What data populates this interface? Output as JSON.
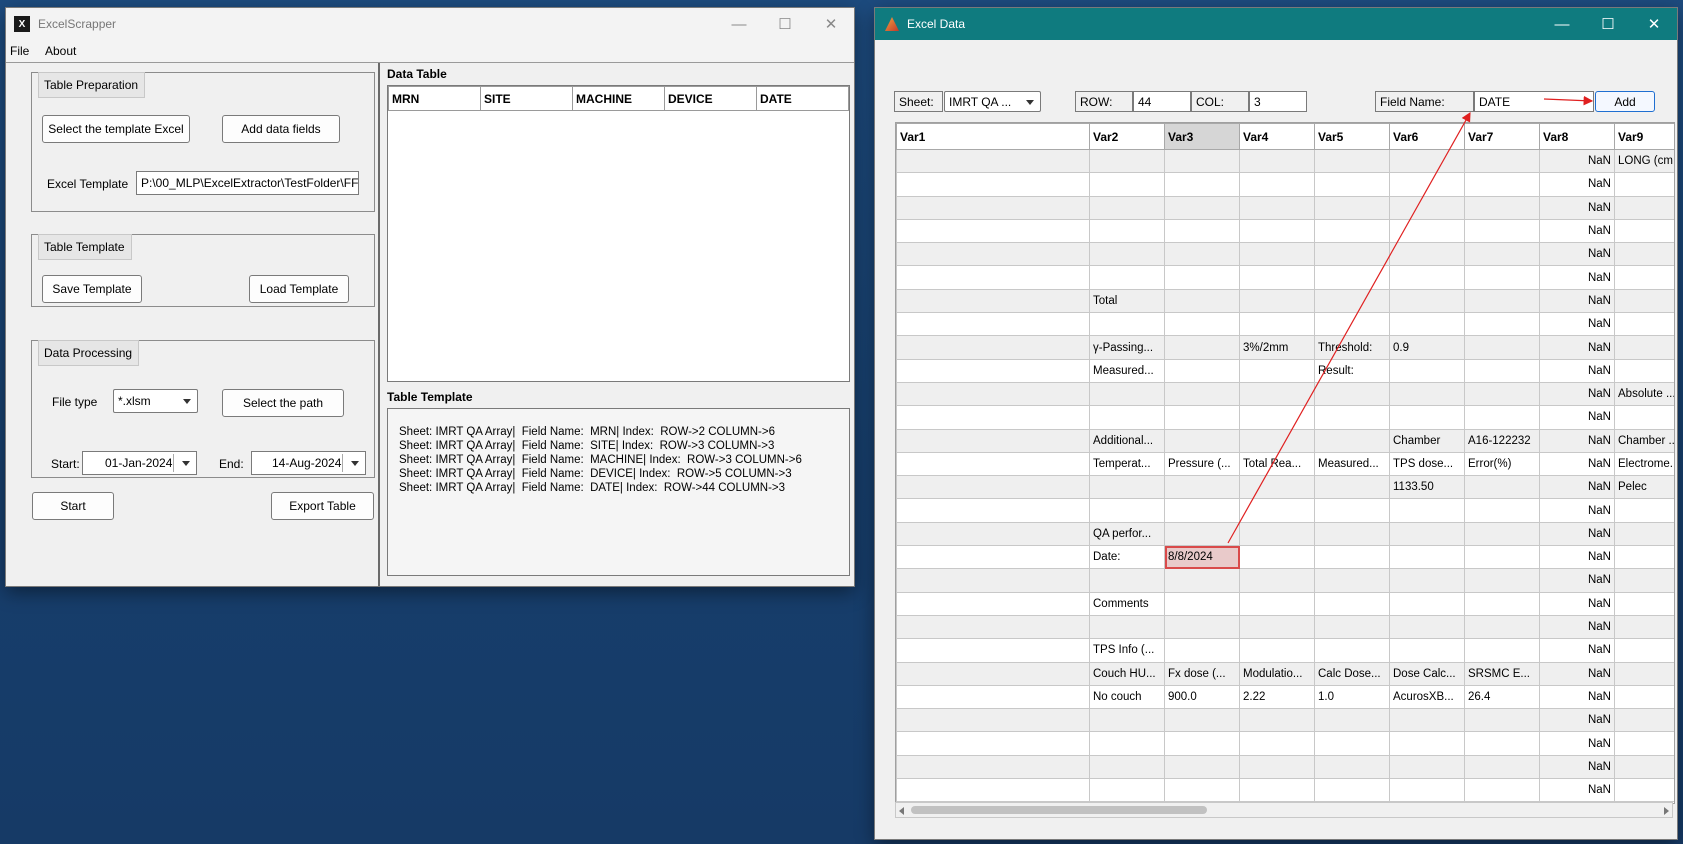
{
  "left_window": {
    "title": "ExcelScrapper",
    "menu": [
      "File",
      "About"
    ],
    "controls": {
      "minimize": "—",
      "maximize": "☐",
      "close": "✕"
    },
    "table_preparation": {
      "title": "Table Preparation",
      "select_template_btn": "Select the template Excel",
      "add_fields_btn": "Add data fields",
      "excel_template_label": "Excel Template",
      "excel_template_value": "P:\\00_MLP\\ExcelExtractor\\TestFolder\\FF"
    },
    "table_template_panel": {
      "title": "Table Template",
      "save_btn": "Save Template",
      "load_btn": "Load Template"
    },
    "data_processing": {
      "title": "Data Processing",
      "file_type_label": "File type",
      "file_type_value": "*.xlsm",
      "select_path_btn": "Select the path",
      "start_label": "Start:",
      "start_value": "01-Jan-2024",
      "end_label": "End:",
      "end_value": "14-Aug-2024"
    },
    "start_btn": "Start",
    "export_btn": "Export Table",
    "data_table": {
      "title": "Data Table",
      "columns": [
        "MRN",
        "SITE",
        "MACHINE",
        "DEVICE",
        "DATE"
      ]
    },
    "table_template": {
      "title": "Table Template",
      "lines": [
        "Sheet: IMRT QA Array|  Field Name:  MRN| Index:  ROW->2 COLUMN->6",
        "Sheet: IMRT QA Array|  Field Name:  SITE| Index:  ROW->3 COLUMN->3",
        "Sheet: IMRT QA Array|  Field Name:  MACHINE| Index:  ROW->3 COLUMN->6",
        "Sheet: IMRT QA Array|  Field Name:  DEVICE| Index:  ROW->5 COLUMN->3",
        "Sheet: IMRT QA Array|  Field Name:  DATE| Index:  ROW->44 COLUMN->3"
      ]
    }
  },
  "right_window": {
    "title": "Excel Data",
    "controls": {
      "minimize": "—",
      "maximize": "☐",
      "close": "✕"
    },
    "sheet_label": "Sheet:",
    "sheet_value": "IMRT QA ...",
    "row_label": "ROW:",
    "row_value": "44",
    "col_label": "COL:",
    "col_value": "3",
    "field_name_label": "Field Name:",
    "field_name_value": "DATE",
    "add_btn": "Add",
    "columns": [
      "Var1",
      "Var2",
      "Var3",
      "Var4",
      "Var5",
      "Var6",
      "Var7",
      "Var8",
      "Var9"
    ],
    "rows": [
      [
        "",
        "",
        "",
        "",
        "",
        "",
        "",
        "NaN",
        "LONG (cm"
      ],
      [
        "",
        "",
        "",
        "",
        "",
        "",
        "",
        "NaN",
        ""
      ],
      [
        "",
        "",
        "",
        "",
        "",
        "",
        "",
        "NaN",
        ""
      ],
      [
        "",
        "",
        "",
        "",
        "",
        "",
        "",
        "NaN",
        ""
      ],
      [
        "",
        "",
        "",
        "",
        "",
        "",
        "",
        "NaN",
        ""
      ],
      [
        "",
        "",
        "",
        "",
        "",
        "",
        "",
        "NaN",
        ""
      ],
      [
        "",
        "Total",
        "",
        "",
        "",
        "",
        "",
        "NaN",
        ""
      ],
      [
        "",
        "",
        "",
        "",
        "",
        "",
        "",
        "NaN",
        ""
      ],
      [
        "",
        "γ-Passing...",
        "",
        "3%/2mm",
        "Threshold:",
        "0.9",
        "",
        "NaN",
        ""
      ],
      [
        "",
        "Measured...",
        "",
        "",
        "Result:",
        "",
        "",
        "NaN",
        ""
      ],
      [
        "",
        "",
        "",
        "",
        "",
        "",
        "",
        "NaN",
        "Absolute ..."
      ],
      [
        "",
        "",
        "",
        "",
        "",
        "",
        "",
        "NaN",
        ""
      ],
      [
        "",
        "Additional...",
        "",
        "",
        "",
        "Chamber",
        "A16-122232",
        "NaN",
        "Chamber ..."
      ],
      [
        "",
        "Temperat...",
        "Pressure (...",
        "Total Rea...",
        "Measured...",
        "TPS dose...",
        "Error(%)",
        "NaN",
        "Electrome..."
      ],
      [
        "",
        "",
        "",
        "",
        "",
        "1133.50",
        "",
        "NaN",
        "Pelec"
      ],
      [
        "",
        "",
        "",
        "",
        "",
        "",
        "",
        "NaN",
        ""
      ],
      [
        "",
        "QA perfor...",
        "",
        "",
        "",
        "",
        "",
        "NaN",
        ""
      ],
      [
        "",
        "Date:",
        "8/8/2024",
        "",
        "",
        "",
        "",
        "NaN",
        ""
      ],
      [
        "",
        "",
        "",
        "",
        "",
        "",
        "",
        "NaN",
        ""
      ],
      [
        "",
        "Comments",
        "",
        "",
        "",
        "",
        "",
        "NaN",
        ""
      ],
      [
        "",
        "",
        "",
        "",
        "",
        "",
        "",
        "NaN",
        ""
      ],
      [
        "",
        "TPS Info (...",
        "",
        "",
        "",
        "",
        "",
        "NaN",
        ""
      ],
      [
        "",
        "Couch HU...",
        "Fx dose (...",
        "Modulatio...",
        "Calc Dose...",
        "Dose Calc...",
        "SRSMC E...",
        "NaN",
        ""
      ],
      [
        "",
        "No couch",
        "900.0",
        "2.22",
        "1.0",
        "AcurosXB...",
        "26.4",
        "NaN",
        ""
      ],
      [
        "",
        "",
        "",
        "",
        "",
        "",
        "",
        "NaN",
        ""
      ],
      [
        "",
        "",
        "",
        "",
        "",
        "",
        "",
        "NaN",
        ""
      ],
      [
        "",
        "",
        "",
        "",
        "",
        "",
        "",
        "NaN",
        ""
      ],
      [
        "",
        "",
        "",
        "",
        "",
        "",
        "",
        "NaN",
        ""
      ]
    ],
    "selected_row_index": 17,
    "selected_col_index": 2
  }
}
